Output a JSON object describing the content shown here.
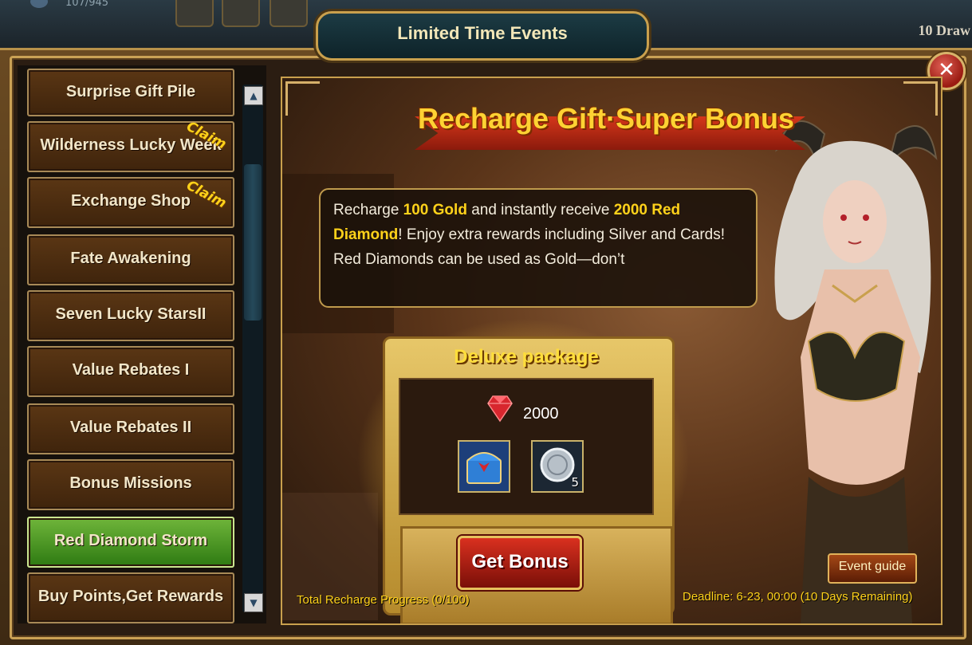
{
  "top_bar": {
    "resource_value": "107/945",
    "draw_label": "10 Draw"
  },
  "window": {
    "title": "Limited Time Events",
    "close_label": "✕"
  },
  "sidebar": {
    "items": [
      {
        "label": "Surprise Gift Pile",
        "active": false,
        "claim": ""
      },
      {
        "label": "Wilderness Lucky Week",
        "active": false,
        "claim": "Claim"
      },
      {
        "label": "Exchange Shop",
        "active": false,
        "claim": "Claim"
      },
      {
        "label": "Fate Awakening",
        "active": false,
        "claim": ""
      },
      {
        "label": "Seven Lucky StarsII",
        "active": false,
        "claim": ""
      },
      {
        "label": "Value Rebates I",
        "active": false,
        "claim": ""
      },
      {
        "label": "Value Rebates II",
        "active": false,
        "claim": ""
      },
      {
        "label": "Bonus Missions",
        "active": false,
        "claim": ""
      },
      {
        "label": "Red Diamond Storm",
        "active": true,
        "claim": ""
      },
      {
        "label": "Buy Points,Get Rewards",
        "active": false,
        "claim": ""
      }
    ],
    "scroll_up": "▲",
    "scroll_down": "▼"
  },
  "event": {
    "title": "Recharge Gift·Super Bonus",
    "description": {
      "part1": "Recharge ",
      "gold": "100 Gold",
      "part2": " and instantly receive ",
      "red_diamond": "2000 Red Diamond",
      "part3": "! Enjoy extra rewards including Silver and Cards! Red Diamonds can be used as Gold—don’t"
    },
    "package_title": "Deluxe package",
    "rewards": {
      "red_diamond_amount": "2000",
      "items": [
        {
          "icon": "treasure-chest-icon",
          "count": ""
        },
        {
          "icon": "silver-coin-icon",
          "count": "5"
        }
      ]
    },
    "get_bonus_label": "Get Bonus",
    "progress_text": "Total Recharge Progress (0/100)",
    "deadline_text": "Deadline: 6-23, 00:00 (10 Days Remaining)",
    "event_guide_label": "Event guide"
  },
  "colors": {
    "accent_gold": "#ffd21a",
    "active_green": "#4c9a22",
    "button_red": "#c0241a",
    "frame_gold": "#caa155"
  }
}
